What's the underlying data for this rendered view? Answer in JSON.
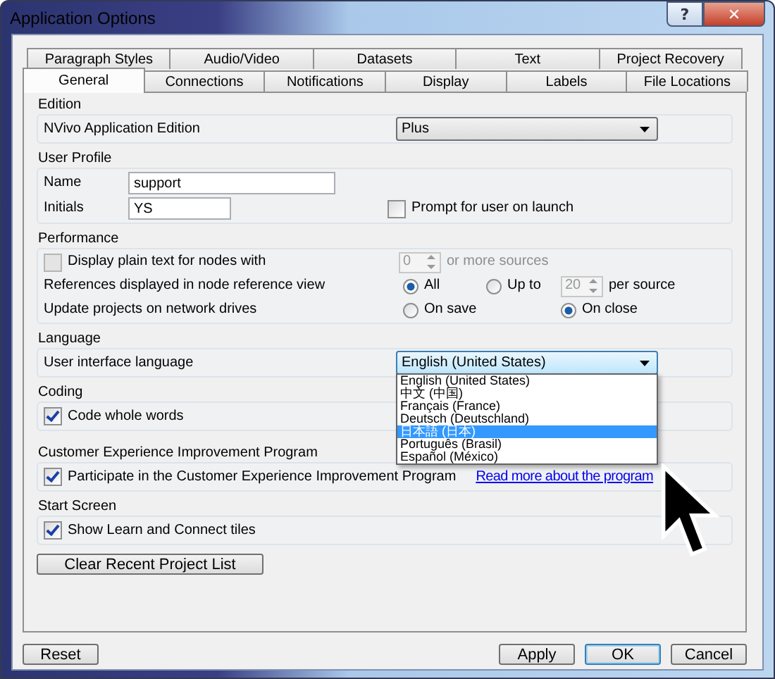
{
  "window": {
    "title": "Application Options",
    "title_buttons": [
      {
        "kind": "help",
        "glyph": "?"
      },
      {
        "kind": "close",
        "glyph": "✕"
      }
    ]
  },
  "tab_rows": [
    {
      "tabs": [
        {
          "label": "Paragraph Styles",
          "selected": false
        },
        {
          "label": "Audio/Video",
          "selected": false
        },
        {
          "label": "Datasets",
          "selected": false
        },
        {
          "label": "Text",
          "selected": false
        },
        {
          "label": "Project Recovery",
          "selected": false
        }
      ]
    },
    {
      "tabs": [
        {
          "label": "General",
          "selected": true
        },
        {
          "label": "Connections",
          "selected": false
        },
        {
          "label": "Notifications",
          "selected": false
        },
        {
          "label": "Display",
          "selected": false
        },
        {
          "label": "Labels",
          "selected": false
        },
        {
          "label": "File Locations",
          "selected": false
        }
      ]
    }
  ],
  "edition": {
    "legend": "Edition",
    "label": "NVivo Application Edition",
    "value": "Plus"
  },
  "user_profile": {
    "legend": "User Profile",
    "name_label": "Name",
    "name_value": "support",
    "initials_label": "Initials",
    "initials_value": "YS",
    "prompt": {
      "label": "Prompt for user on launch",
      "checked": false
    }
  },
  "performance": {
    "legend": "Performance",
    "plain_text": {
      "label": "Display plain text for nodes with",
      "checked": false,
      "disabled": true
    },
    "min_sources": {
      "value": "0",
      "suffix": "or more sources",
      "disabled": true
    },
    "references_label": "References displayed in node reference view",
    "references_options": [
      {
        "label": "All",
        "selected": true
      },
      {
        "label": "Up to",
        "selected": false
      }
    ],
    "per_source": {
      "value": "20",
      "suffix": "per source",
      "disabled": true
    },
    "update_label": "Update projects on network drives",
    "update_options": [
      {
        "label": "On save",
        "selected": false
      },
      {
        "label": "On close",
        "selected": true
      }
    ]
  },
  "language": {
    "legend": "Language",
    "label": "User interface language",
    "value": "English (United States)",
    "expanded": true,
    "options": [
      {
        "label": "English (United States)",
        "highlighted": false
      },
      {
        "label": "中文 (中国)",
        "highlighted": false
      },
      {
        "label": "Français (France)",
        "highlighted": false
      },
      {
        "label": "Deutsch (Deutschland)",
        "highlighted": false
      },
      {
        "label": "日本語 (日本)",
        "highlighted": true
      },
      {
        "label": "Português (Brasil)",
        "highlighted": false
      },
      {
        "label": "Español (México)",
        "highlighted": false
      }
    ]
  },
  "coding": {
    "legend": "Coding",
    "checkbox": {
      "label": "Code whole words",
      "checked": true
    }
  },
  "ceip": {
    "legend": "Customer Experience Improvement Program",
    "checkbox": {
      "label": "Participate in the Customer Experience Improvement Program",
      "checked": true
    },
    "link": "Read more about the program"
  },
  "start_screen": {
    "legend": "Start Screen",
    "checkbox": {
      "label": "Show Learn and Connect tiles",
      "checked": true
    }
  },
  "clear_button": "Clear Recent Project List",
  "reset_button": "Reset",
  "buttons": [
    {
      "label": "Apply",
      "default": false
    },
    {
      "label": "OK",
      "default": true
    },
    {
      "label": "Cancel",
      "default": false
    }
  ]
}
